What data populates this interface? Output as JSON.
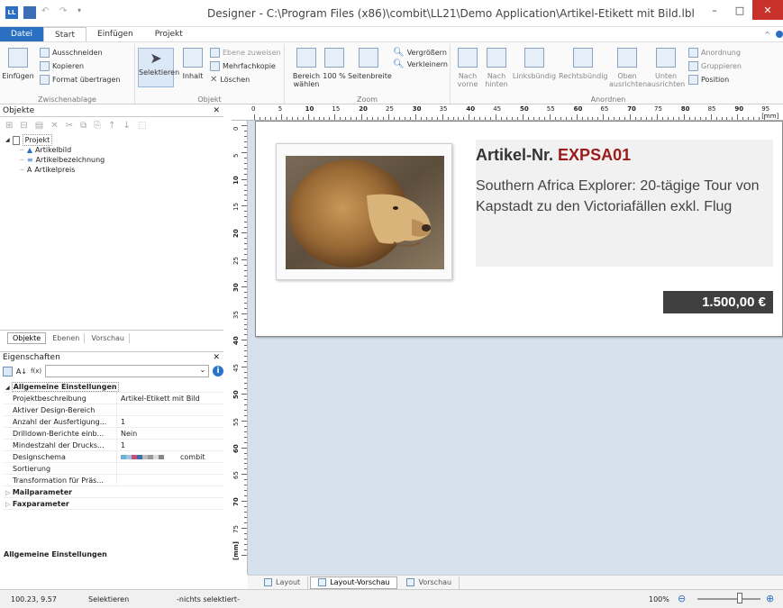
{
  "window": {
    "title": "Designer - C:\\Program Files (x86)\\combit\\LL21\\Demo Application\\Artikel-Etikett mit Bild.lbl",
    "app_icon": "LL"
  },
  "tabs": [
    "Datei",
    "Start",
    "Einfügen",
    "Projekt"
  ],
  "ribbon": {
    "clipboard": {
      "paste": "Einfügen",
      "cut": "Ausschneiden",
      "copy": "Kopieren",
      "format": "Format übertragen",
      "group": "Zwischenablage"
    },
    "object": {
      "select": "Selektieren",
      "content": "Inhalt",
      "assign_layer": "Ebene zuweisen",
      "multi_copy": "Mehrfachkopie",
      "delete": "Löschen",
      "group": "Objekt"
    },
    "zoom": {
      "area": "Bereich wählen",
      "hundred": "100 %",
      "page_width": "Seitenbreite",
      "zoom_in": "Vergrößern",
      "zoom_out": "Verkleinern",
      "group": "Zoom"
    },
    "arrange": {
      "front": "Nach vorne",
      "back": "Nach hinten",
      "left": "Linksbündig",
      "right": "Rechtsbündig",
      "top": "Oben ausrichten",
      "bottom": "Unten ausrichten",
      "arrangement": "Anordnung",
      "grouping": "Gruppieren",
      "position": "Position",
      "group": "Anordnen"
    }
  },
  "objects_panel": {
    "title": "Objekte",
    "tree": {
      "root": "Projekt",
      "children": [
        {
          "icon": "image",
          "label": "Artikelbild"
        },
        {
          "icon": "text",
          "label": "Artikelbezeichnung"
        },
        {
          "icon": "A",
          "label": "Artikelpreis"
        }
      ]
    },
    "tabs": [
      "Objekte",
      "Ebenen",
      "Vorschau"
    ]
  },
  "properties_panel": {
    "title": "Eigenschaften",
    "rows": [
      {
        "type": "cat",
        "key": "Allgemeine Einstellungen"
      },
      {
        "key": "Projektbeschreibung",
        "value": "Artikel-Etikett mit Bild"
      },
      {
        "key": "Aktiver Design-Bereich",
        "value": ""
      },
      {
        "key": "Anzahl der Ausfertigung...",
        "value": "1"
      },
      {
        "key": "Drilldown-Berichte einb...",
        "value": "Nein"
      },
      {
        "key": "Mindestzahl der Drucks...",
        "value": "1"
      },
      {
        "key": "Designschema",
        "value": "combit"
      },
      {
        "key": "Sortierung",
        "value": ""
      },
      {
        "key": "Transformation für Präs...",
        "value": ""
      },
      {
        "type": "cat",
        "key": "Mailparameter"
      },
      {
        "type": "cat",
        "key": "Faxparameter"
      }
    ],
    "description": "Allgemeine Einstellungen"
  },
  "ruler": {
    "top_numbers": [
      "0",
      "5",
      "10",
      "15",
      "20",
      "25",
      "30",
      "35",
      "40",
      "45",
      "50",
      "55",
      "60",
      "65",
      "70",
      "75",
      "80",
      "85",
      "90",
      "95 [mm]"
    ],
    "left_numbers": [
      "0",
      "5",
      "10",
      "15",
      "20",
      "25",
      "30",
      "35",
      "40",
      "45",
      "50",
      "55",
      "60",
      "65",
      "70",
      "75",
      "[mm]"
    ]
  },
  "label": {
    "article_prefix": "Artikel-Nr.",
    "article_nr": "EXPSA01",
    "description": "Southern Africa Explorer: 20-tägige Tour von Kapstadt zu den Victoriafällen exkl. Flug",
    "price": "1.500,00 €"
  },
  "view_tabs": [
    "Layout",
    "Layout-Vorschau",
    "Vorschau"
  ],
  "status": {
    "coords": "100.23, 9.57",
    "mode": "Selektieren",
    "selection": "-nichts selektiert-",
    "zoom": "100%"
  },
  "colors": {
    "accent": "#2b6fc2",
    "article_nr": "#9b1b1b",
    "price_bg": "#3f3f3f",
    "design_bg": "#d6e1ee"
  }
}
